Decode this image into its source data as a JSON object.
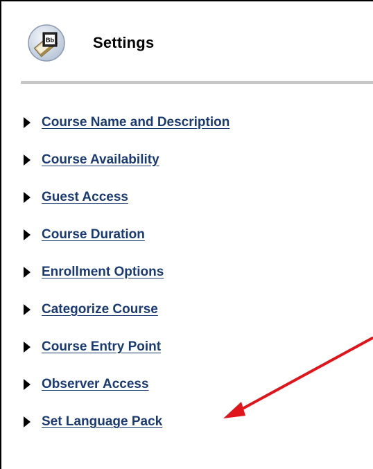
{
  "header": {
    "title": "Settings",
    "icon": "bb-settings-icon"
  },
  "menu": {
    "items": [
      {
        "label": "Course Name and Description"
      },
      {
        "label": "Course Availability"
      },
      {
        "label": "Guest Access"
      },
      {
        "label": "Course Duration"
      },
      {
        "label": "Enrollment Options"
      },
      {
        "label": "Categorize Course"
      },
      {
        "label": "Course Entry Point"
      },
      {
        "label": "Observer Access"
      },
      {
        "label": "Set Language Pack"
      }
    ]
  },
  "annotation": {
    "arrow_color": "#e0141b"
  },
  "colors": {
    "link": "#1a3a72",
    "divider": "#c6c6c6",
    "border": "#000000"
  }
}
